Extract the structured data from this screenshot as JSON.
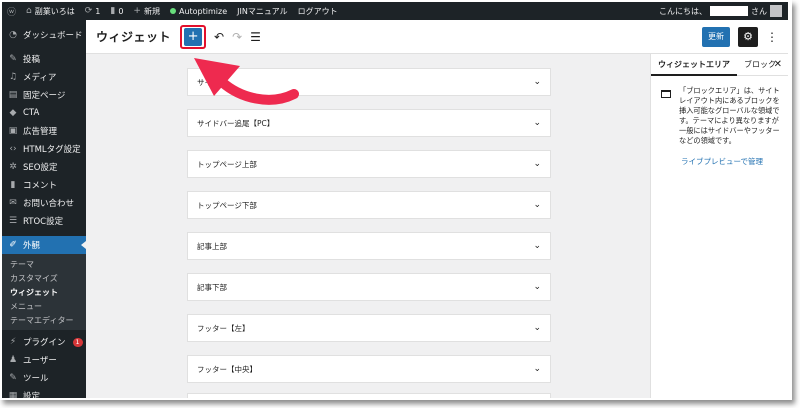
{
  "admin_bar": {
    "site_name": "副業いろは",
    "updates_count": "1",
    "comments_count": "0",
    "new_label": "新規",
    "autoptimize_label": "Autoptimize",
    "jin_manual_label": "JINマニュアル",
    "logout_label": "ログアウト",
    "greeting_prefix": "こんにちは、",
    "greeting_suffix": "さん"
  },
  "sidebar": {
    "dashboard": "ダッシュボード",
    "posts": "投稿",
    "media": "メディア",
    "pages": "固定ページ",
    "cta": "CTA",
    "ads": "広告管理",
    "html_tags": "HTMLタグ設定",
    "seo": "SEO設定",
    "comments": "コメント",
    "contact": "お問い合わせ",
    "rtoc": "RTOC設定",
    "appearance": "外観",
    "sub_theme": "テーマ",
    "sub_customize": "カスタマイズ",
    "sub_widgets": "ウィジェット",
    "sub_menus": "メニュー",
    "sub_theme_editor": "テーマエディター",
    "plugins": "プラグイン",
    "plugins_badge": "1",
    "users": "ユーザー",
    "tools": "ツール",
    "settings": "設定"
  },
  "header": {
    "title": "ウィジェット",
    "update_label": "更新"
  },
  "widget_areas": [
    "サイ",
    "サイドバー追尾【PC】",
    "トップページ上部",
    "トップページ下部",
    "記事上部",
    "記事下部",
    "フッター【左】",
    "フッター【中央】"
  ],
  "panel": {
    "tab_widget_area": "ウィジェットエリア",
    "tab_block": "ブロック",
    "description": "「ブロックエリア」は、サイトレイアウト内にあるブロックを挿入可能なグローバルな領域です。テーマにより異なりますが一般にはサイドバーやフッターなどの領域です。",
    "live_preview_link": "ライブプレビューで管理"
  },
  "colors": {
    "admin_dark": "#1d2327",
    "accent_blue": "#2271b1",
    "highlight_red": "#e2102c",
    "arrow_pink": "#ee2a4f"
  }
}
